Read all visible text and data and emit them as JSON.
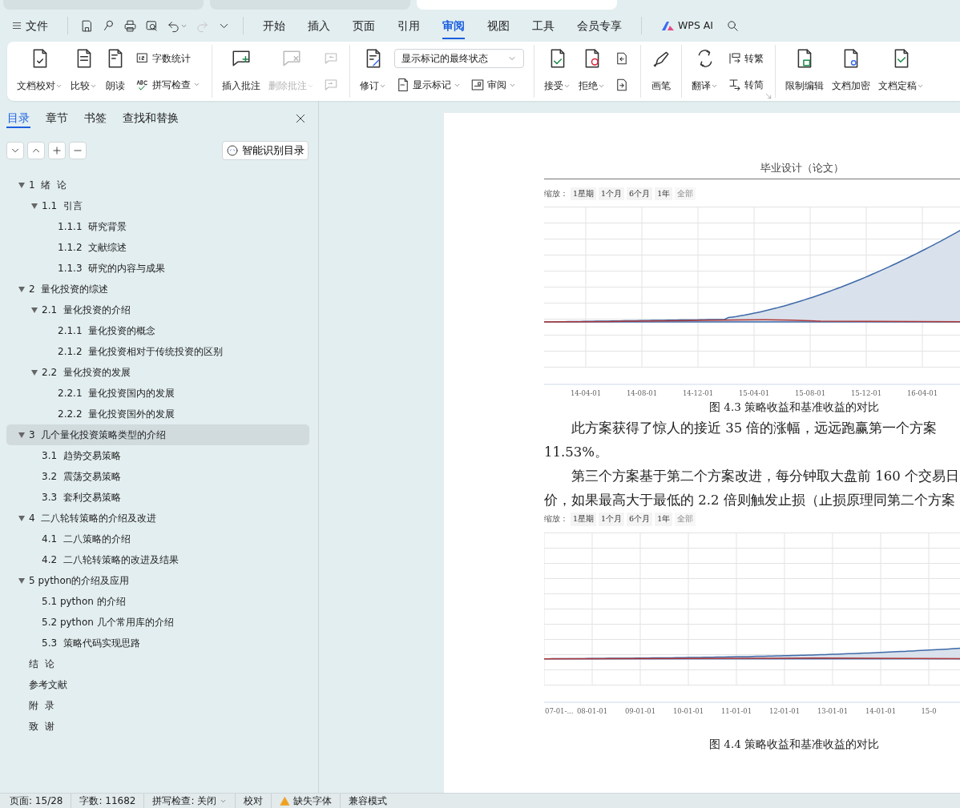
{
  "window": {
    "doc_tabs": [
      {
        "selected": false
      },
      {
        "selected": false
      },
      {
        "selected": true
      }
    ]
  },
  "menu": {
    "file": "文件",
    "quick_access": [
      {
        "disabled": false,
        "dropdown": false
      },
      {
        "disabled": false,
        "dropdown": false
      },
      {
        "disabled": false,
        "dropdown": false
      },
      {
        "disabled": false,
        "dropdown": false
      },
      {
        "disabled": false,
        "dropdown": true
      },
      {
        "disabled": true,
        "dropdown": false
      },
      {
        "disabled": false,
        "dropdown": false
      }
    ],
    "tabs": [
      {
        "label": "开始",
        "selected": false
      },
      {
        "label": "插入",
        "selected": false
      },
      {
        "label": "页面",
        "selected": false
      },
      {
        "label": "引用",
        "selected": false
      },
      {
        "label": "审阅",
        "selected": true
      },
      {
        "label": "视图",
        "selected": false
      },
      {
        "label": "工具",
        "selected": false
      },
      {
        "label": "会员专享",
        "selected": false
      }
    ],
    "ai": "WPS AI"
  },
  "ribbon": {
    "groups": [
      {
        "columns": [
          {
            "kind": "large",
            "label": "文档校对",
            "dropdown": true,
            "disabled": false
          },
          {
            "kind": "large",
            "label": "比较",
            "dropdown": true,
            "disabled": false
          },
          {
            "kind": "large",
            "label": "朗读",
            "dropdown": false,
            "disabled": false
          },
          {
            "kind": "stack",
            "rows": [
              [
                {
                  "kind": "small",
                  "label": "字数统计",
                  "dropdown": false,
                  "disabled": false
                }
              ],
              [
                {
                  "kind": "small",
                  "label": "拼写检查",
                  "dropdown": true,
                  "disabled": false
                }
              ]
            ]
          }
        ]
      },
      {
        "columns": [
          {
            "kind": "large",
            "label": "插入批注",
            "dropdown": false,
            "disabled": false
          },
          {
            "kind": "large",
            "label": "删除批注",
            "dropdown": true,
            "disabled": true
          },
          {
            "kind": "stack",
            "rows": [
              [
                {
                  "kind": "small",
                  "dropdown": false,
                  "disabled": true
                }
              ],
              [
                {
                  "kind": "small",
                  "dropdown": false,
                  "disabled": true
                }
              ]
            ]
          }
        ]
      },
      {
        "columns": [
          {
            "kind": "large",
            "label": "修订",
            "dropdown": true,
            "disabled": false
          },
          {
            "kind": "stack",
            "rows": [
              [
                {
                  "kind": "select",
                  "value": "显示标记的最终状态"
                }
              ],
              [
                {
                  "kind": "small",
                  "label": "显示标记",
                  "dropdown": true,
                  "disabled": false
                },
                {
                  "kind": "small",
                  "label": "审阅",
                  "dropdown": true,
                  "disabled": false
                }
              ]
            ]
          }
        ]
      },
      {
        "columns": [
          {
            "kind": "large",
            "label": "接受",
            "dropdown": true,
            "disabled": false
          },
          {
            "kind": "large",
            "label": "拒绝",
            "dropdown": true,
            "disabled": false
          },
          {
            "kind": "stack",
            "rows": [
              [
                {
                  "kind": "small",
                  "dropdown": false,
                  "disabled": false
                }
              ],
              [
                {
                  "kind": "small",
                  "dropdown": false,
                  "disabled": false
                }
              ]
            ]
          }
        ]
      },
      {
        "columns": [
          {
            "kind": "large",
            "label": "画笔",
            "dropdown": false,
            "disabled": false
          }
        ]
      },
      {
        "columns": [
          {
            "kind": "large",
            "label": "翻译",
            "dropdown": true,
            "disabled": false
          },
          {
            "kind": "stack",
            "rows": [
              [
                {
                  "kind": "small",
                  "label": "转繁",
                  "dropdown": false,
                  "disabled": false
                }
              ],
              [
                {
                  "kind": "small",
                  "label": "转简",
                  "dropdown": false,
                  "disabled": false
                }
              ]
            ]
          }
        ],
        "launcher": true
      },
      {
        "columns": [
          {
            "kind": "large",
            "label": "限制编辑",
            "dropdown": false,
            "disabled": false
          },
          {
            "kind": "large",
            "label": "文档加密",
            "dropdown": false,
            "disabled": false
          },
          {
            "kind": "large",
            "label": "文档定稿",
            "dropdown": true,
            "disabled": false
          }
        ]
      }
    ]
  },
  "sidebar": {
    "tabs": [
      {
        "label": "目录",
        "selected": true
      },
      {
        "label": "章节",
        "selected": false
      },
      {
        "label": "书签",
        "selected": false
      },
      {
        "label": "查找和替换",
        "selected": false
      }
    ],
    "smart_button": "智能识别目录",
    "items": [
      {
        "label": "1  绪  论",
        "expanded": true,
        "selected": false,
        "children": [
          {
            "label": "1.1  引言",
            "expanded": true,
            "selected": false,
            "children": [
              {
                "label": "1.1.1  研究背景",
                "selected": false
              },
              {
                "label": "1.1.2  文献综述",
                "selected": false
              },
              {
                "label": "1.1.3  研究的内容与成果",
                "selected": false
              }
            ]
          }
        ]
      },
      {
        "label": "2  量化投资的综述",
        "expanded": true,
        "selected": false,
        "children": [
          {
            "label": "2.1  量化投资的介绍",
            "expanded": true,
            "selected": false,
            "children": [
              {
                "label": "2.1.1  量化投资的概念",
                "selected": false
              },
              {
                "label": "2.1.2  量化投资相对于传统投资的区别",
                "selected": false
              }
            ]
          },
          {
            "label": "2.2  量化投资的发展",
            "expanded": true,
            "selected": false,
            "children": [
              {
                "label": "2.2.1  量化投资国内的发展",
                "selected": false
              },
              {
                "label": "2.2.2  量化投资国外的发展",
                "selected": false
              }
            ]
          }
        ]
      },
      {
        "label": "3  几个量化投资策略类型的介绍",
        "expanded": true,
        "selected": true,
        "children": [
          {
            "label": "3.1  趋势交易策略",
            "selected": false
          },
          {
            "label": "3.2  震荡交易策略",
            "selected": false
          },
          {
            "label": "3.3  套利交易策略",
            "selected": false
          }
        ]
      },
      {
        "label": "4  二八轮转策略的介绍及改进",
        "expanded": true,
        "selected": false,
        "children": [
          {
            "label": "4.1  二八策略的介绍",
            "selected": false
          },
          {
            "label": "4.2  二八轮转策略的改进及结果",
            "selected": false
          }
        ]
      },
      {
        "label": "5 python的介绍及应用",
        "expanded": true,
        "selected": false,
        "children": [
          {
            "label": "5.1 python 的介绍",
            "selected": false
          },
          {
            "label": "5.2 python 几个常用库的介绍",
            "selected": false
          },
          {
            "label": "5.3  策略代码实现思路",
            "selected": false
          }
        ]
      },
      {
        "label": "结  论",
        "selected": false
      },
      {
        "label": "参考文献",
        "selected": false
      },
      {
        "label": "附  录",
        "selected": false
      },
      {
        "label": "致  谢",
        "selected": false
      }
    ]
  },
  "document": {
    "header": "毕业设计（论文）",
    "blocks": [
      {
        "kind": "chart",
        "zoom_label": "缩放：",
        "zoom_buttons": [
          {
            "label": "1星期",
            "disabled": false
          },
          {
            "label": "1个月",
            "disabled": false
          },
          {
            "label": "6个月",
            "disabled": false
          },
          {
            "label": "1年",
            "disabled": false
          },
          {
            "label": "全部",
            "disabled": true
          }
        ],
        "x_labels": [
          "14-04-01",
          "14-08-01",
          "14-12-01",
          "15-04-01",
          "15-08-01",
          "15-12-01",
          "16-04-01"
        ]
      },
      {
        "kind": "caption",
        "text": "图 4.3  策略收益和基准收益的对比"
      },
      {
        "kind": "line",
        "indent": true,
        "text": "此方案获得了惊人的接近 35 倍的涨幅，远远跑赢第一个方案"
      },
      {
        "kind": "line",
        "indent": false,
        "text": "11.53%。"
      },
      {
        "kind": "line",
        "indent": true,
        "text": "第三个方案基于第二个方案改进，每分钟取大盘前 160 个交易日"
      },
      {
        "kind": "line",
        "indent": false,
        "text": "价，如果最高大于最低的 2.2 倍则触发止损（止损原理同第二个方案"
      },
      {
        "kind": "chart",
        "zoom_label": "缩放：",
        "zoom_buttons": [
          {
            "label": "1星期",
            "disabled": false
          },
          {
            "label": "1个月",
            "disabled": false
          },
          {
            "label": "6个月",
            "disabled": false
          },
          {
            "label": "1年",
            "disabled": false
          },
          {
            "label": "全部",
            "disabled": true
          }
        ],
        "x_labels": [
          "07-01-...",
          "08-01-01",
          "09-01-01",
          "10-01-01",
          "11-01-01",
          "12-01-01",
          "13-01-01",
          "14-01-01",
          "15-0"
        ]
      },
      {
        "kind": "caption",
        "text": "图 4.4  策略收益和基准收益的对比"
      }
    ]
  },
  "status_bar": [
    {
      "kind": "text",
      "text": "页面: 15/28"
    },
    {
      "kind": "text",
      "text": "字数: 11682"
    },
    {
      "kind": "dropdown",
      "text": "拼写检查: 关闭"
    },
    {
      "kind": "text",
      "text": "校对"
    },
    {
      "kind": "warning",
      "text": "缺失字体"
    },
    {
      "kind": "text",
      "text": "兼容模式"
    }
  ]
}
